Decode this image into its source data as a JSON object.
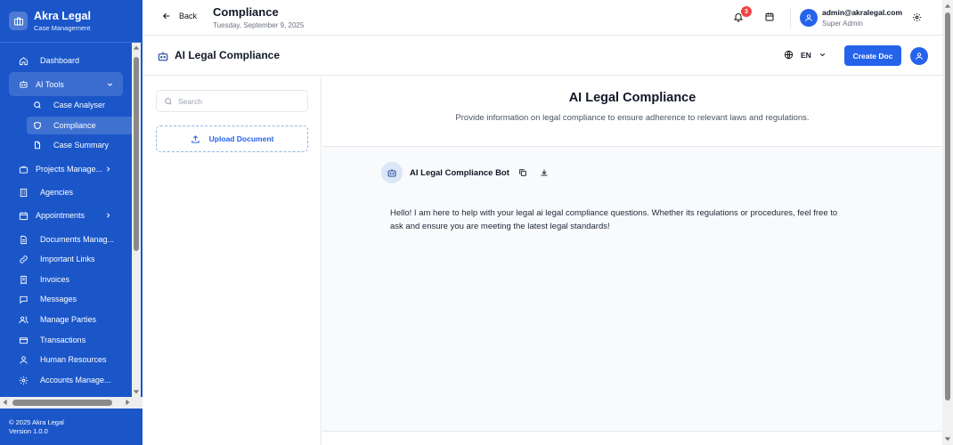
{
  "brand": {
    "name": "Akra Legal",
    "subtitle": "Case Management"
  },
  "sidebar": {
    "items": [
      {
        "label": "Dashboard",
        "icon": "home-icon"
      },
      {
        "label": "AI Tools",
        "icon": "robot-icon",
        "expanded": true
      },
      {
        "label": "Case Analyser",
        "icon": "search-icon"
      },
      {
        "label": "Compliance",
        "icon": "shield-icon",
        "active": true
      },
      {
        "label": "Case Summary",
        "icon": "document-icon"
      },
      {
        "label": "Projects Manage...",
        "icon": "briefcase-icon"
      },
      {
        "label": "Agencies",
        "icon": "building-icon"
      },
      {
        "label": "Appointments",
        "icon": "calendar-icon"
      },
      {
        "label": "Documents Manag...",
        "icon": "file-icon"
      },
      {
        "label": "Important Links",
        "icon": "link-icon"
      },
      {
        "label": "Invoices",
        "icon": "receipt-icon"
      },
      {
        "label": "Messages",
        "icon": "chat-icon"
      },
      {
        "label": "Manage Parties",
        "icon": "users-icon"
      },
      {
        "label": "Transactions",
        "icon": "credit-card-icon"
      },
      {
        "label": "Human Resources",
        "icon": "user-icon"
      },
      {
        "label": "Accounts Manage...",
        "icon": "gear-icon"
      }
    ],
    "footer": {
      "copyright": "© 2025 Akra Legal",
      "version": "Version 1.0.0"
    }
  },
  "topbar": {
    "back_label": "Back",
    "title": "Compliance",
    "date": "Tuesday, September 9, 2025",
    "notification_count": "3",
    "user_email": "admin@akralegal.com",
    "user_role": "Super Admin"
  },
  "content_header": {
    "title": "AI Legal Compliance",
    "language": "EN",
    "create_doc_label": "Create Doc"
  },
  "left_panel": {
    "search_placeholder": "Search",
    "upload_label": "Upload Document"
  },
  "main": {
    "title": "AI Legal Compliance",
    "subtitle": "Provide information on legal compliance to ensure adherence to relevant laws and regulations.",
    "bot_name": "AI Legal Compliance Bot",
    "message_line1": "Hello! I am here to help with your legal ai legal compliance questions. Whether its regulations or procedures, feel free to",
    "message_line2": "ask and ensure you are meeting the latest legal standards!"
  },
  "colors": {
    "primary": "#2563eb",
    "sidebar": "#1b56c9",
    "badge": "#ef4444"
  }
}
